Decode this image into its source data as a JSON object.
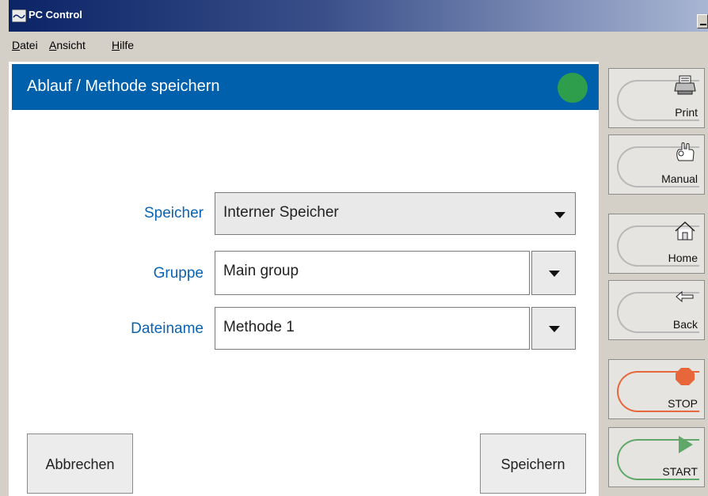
{
  "window": {
    "title": "PC Control"
  },
  "menu": {
    "datei": "Datei",
    "ansicht": "Ansicht",
    "hilfe": "Hilfe"
  },
  "header": {
    "title": "Ablauf / Methode speichern",
    "status_color": "#2e9e4d"
  },
  "form": {
    "speicher_label": "Speicher",
    "speicher_value": "Interner Speicher",
    "gruppe_label": "Gruppe",
    "gruppe_value": "Main group",
    "dateiname_label": "Dateiname",
    "dateiname_value": "Methode 1"
  },
  "actions": {
    "cancel": "Abbrechen",
    "save": "Speichern"
  },
  "sidebar": {
    "print": "Print",
    "manual": "Manual",
    "home": "Home",
    "back": "Back",
    "stop": "STOP",
    "start": "START",
    "stop_color": "#e8673a",
    "start_color": "#5fa86a"
  }
}
